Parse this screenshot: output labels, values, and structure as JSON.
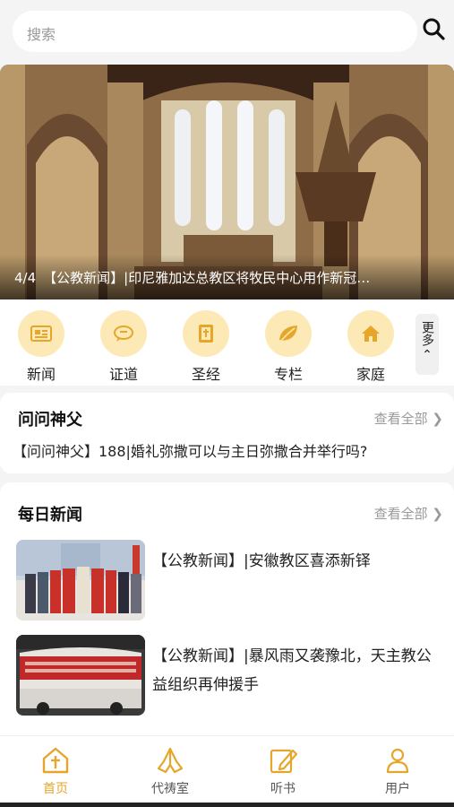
{
  "search": {
    "placeholder": "搜索"
  },
  "banner": {
    "index": "4/4",
    "caption": "【公教新闻】|印尼雅加达总教区将牧民中心用作新冠…"
  },
  "categories": [
    {
      "label": "新闻",
      "icon": "newspaper-icon"
    },
    {
      "label": "证道",
      "icon": "speech-bubble-icon"
    },
    {
      "label": "圣经",
      "icon": "bible-icon"
    },
    {
      "label": "专栏",
      "icon": "leaf-icon"
    },
    {
      "label": "家庭",
      "icon": "home-icon"
    }
  ],
  "more": {
    "label": "更多"
  },
  "ask_father": {
    "title": "问问神父",
    "see_all": "查看全部",
    "question": "【问问神父】188|婚礼弥撒可以与主日弥撒合并举行吗?"
  },
  "daily_news": {
    "title": "每日新闻",
    "see_all": "查看全部",
    "items": [
      {
        "title": "【公教新闻】|安徽教区喜添新铎"
      },
      {
        "title": "【公教新闻】|暴风雨又袭豫北，天主教公益组织再伸援手"
      }
    ]
  },
  "tabs": [
    {
      "label": "首页",
      "icon": "church-home-icon",
      "active": true
    },
    {
      "label": "代祷室",
      "icon": "praying-hands-icon",
      "active": false
    },
    {
      "label": "听书",
      "icon": "edit-book-icon",
      "active": false
    },
    {
      "label": "用户",
      "icon": "user-icon",
      "active": false
    }
  ],
  "colors": {
    "accent": "#e6a62a",
    "icon_bg": "#fde9b5"
  }
}
